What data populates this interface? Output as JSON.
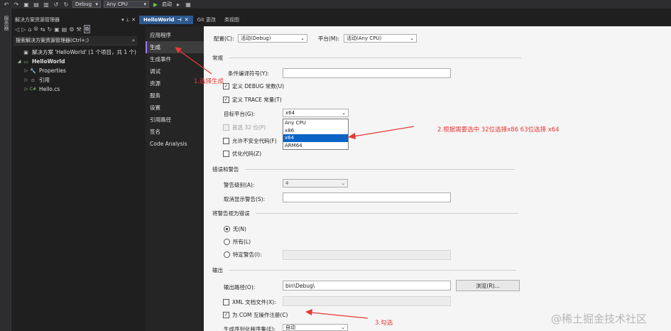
{
  "toolbar": {
    "config_combo": "Debug",
    "platform_combo": "Any CPU",
    "start_label": "启动"
  },
  "left_strip": {
    "label": "服务器"
  },
  "solution_explorer": {
    "title": "解决方案资源管理器",
    "header_controls": "▾ ⊥ ✕",
    "search_placeholder": "搜索解决方案资源管理器(Ctrl+;)",
    "tree": [
      {
        "label": "解决方案 'HelloWorld' (1 个项目，共 1 个)",
        "icon": "solution-icon",
        "level": 0,
        "arrow": "",
        "bold": false
      },
      {
        "label": "HelloWorld",
        "icon": "project-icon",
        "level": 0,
        "arrow": "◢",
        "bold": true
      },
      {
        "label": "Properties",
        "icon": "wrench-icon",
        "level": 1,
        "arrow": "▷",
        "bold": false
      },
      {
        "label": "引用",
        "icon": "references-icon",
        "level": 1,
        "arrow": "▷",
        "bold": false
      },
      {
        "label": "Hello.cs",
        "icon": "csharp-file-icon",
        "level": 1,
        "arrow": "▷",
        "bold": false
      }
    ]
  },
  "tabs": [
    {
      "label": "HelloWorld",
      "active": true
    },
    {
      "label": "Git 更改",
      "active": false
    },
    {
      "label": "类视图",
      "active": false
    }
  ],
  "prop_nav": [
    {
      "label": "应用程序",
      "active": false
    },
    {
      "label": "生成",
      "active": true
    },
    {
      "label": "生成事件",
      "active": false
    },
    {
      "label": "调试",
      "active": false
    },
    {
      "label": "资源",
      "active": false
    },
    {
      "label": "服务",
      "active": false
    },
    {
      "label": "设置",
      "active": false
    },
    {
      "label": "引用路径",
      "active": false
    },
    {
      "label": "签名",
      "active": false
    },
    {
      "label": "Code Analysis",
      "active": false
    }
  ],
  "main": {
    "config_label": "配置(C):",
    "config_value": "活动(Debug)",
    "platform_label": "平台(M):",
    "platform_value": "活动(Any CPU)",
    "general_section": "常规",
    "conditional_symbols_label": "条件编译符号(Y):",
    "conditional_symbols_value": "",
    "define_debug_label": "定义 DEBUG 常数(U)",
    "define_debug_checked": true,
    "define_trace_label": "定义 TRACE 常量(T)",
    "define_trace_checked": true,
    "target_platform_label": "目标平台(G):",
    "target_platform_value": "x64",
    "prefer32_label": "首选 32 位(P)",
    "allow_unsafe_label": "允许不安全代码(F)",
    "optimize_label": "优化代码(Z)",
    "platform_options": [
      "Any CPU",
      "x86",
      "x64",
      "ARM64"
    ],
    "platform_selected_index": 2,
    "errors_section": "错误和警告",
    "warning_level_label": "警告级别(A):",
    "warning_level_value": "4",
    "suppress_warnings_label": "取消显示警告(S):",
    "suppress_warnings_value": "",
    "treat_as_errors_section": "将警告视为错误",
    "radio_none_label": "无(N)",
    "radio_all_label": "所有(L)",
    "radio_specific_label": "特定警告(I):",
    "output_section": "输出",
    "output_path_label": "输出路径(O):",
    "output_path_value": "bin\\Debug\\",
    "browse_button": "浏览(R)...",
    "xml_doc_label": "XML 文档文件(X):",
    "com_interop_label": "为 COM 互操作注册(C)",
    "com_interop_checked": true,
    "serialization_label": "生成序列化程序集(E):",
    "serialization_value": "自动"
  },
  "annotations": {
    "step1": "1.选择生成",
    "step2": "2.根据需要选中  32位选择x86  63位选择 x64",
    "step3": "3.勾选",
    "color": "#e53935"
  },
  "watermark": "@稀土掘金技术社区"
}
